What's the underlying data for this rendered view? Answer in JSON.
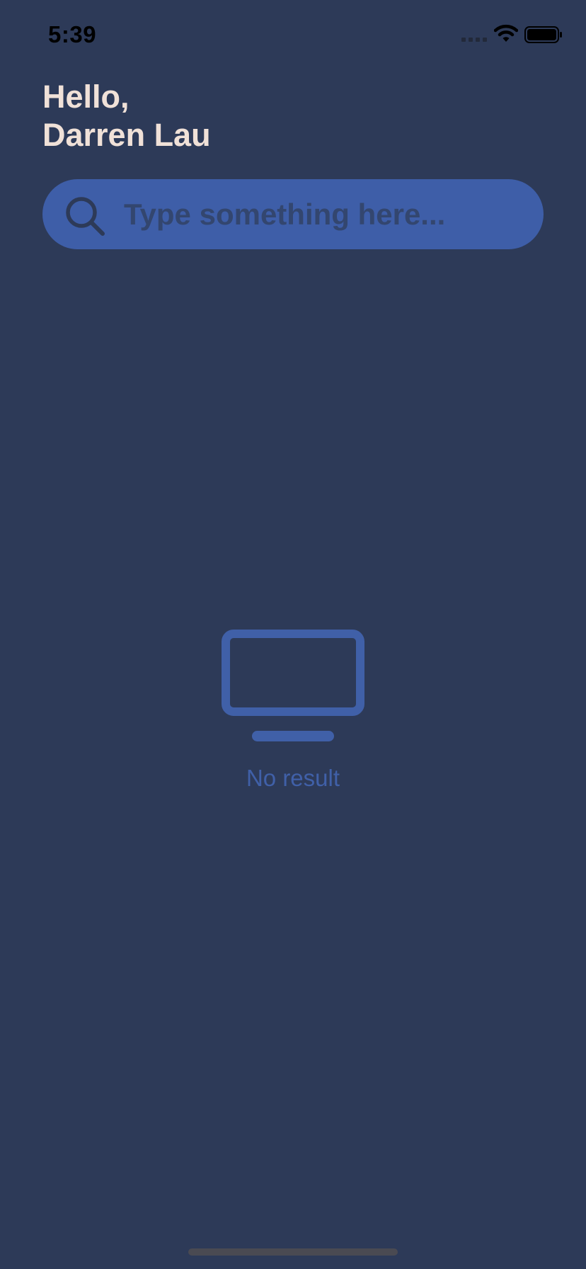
{
  "status_bar": {
    "time": "5:39",
    "signal_icon": "signal-bars-icon",
    "wifi_icon": "wifi-icon",
    "battery_icon": "battery-icon"
  },
  "greeting": {
    "line1": "Hello,",
    "line2": "Darren Lau"
  },
  "search": {
    "value": "",
    "placeholder": "Type something here...",
    "icon": "search-icon"
  },
  "empty_state": {
    "icon": "tv-icon",
    "label": "No result"
  },
  "colors": {
    "background": "#2d3a58",
    "accent": "#3e5ea8",
    "greeting_text": "#f0e1d8",
    "empty_text": "#4060a8"
  }
}
